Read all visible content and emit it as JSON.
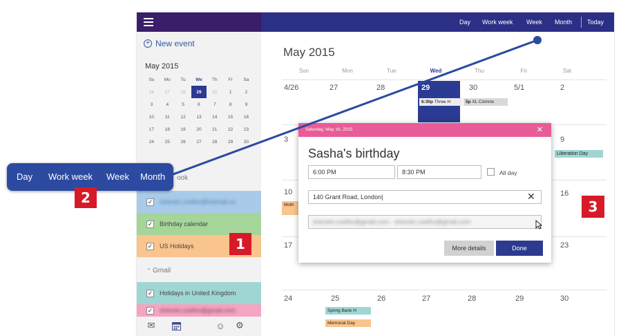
{
  "sidebar": {
    "new_event": "New event",
    "mini_title": "May 2015",
    "mini_dows": [
      "Su",
      "Mo",
      "Tu",
      "We",
      "Th",
      "Fr",
      "Sa"
    ],
    "mini_weeks": [
      [
        "26",
        "27",
        "28",
        "29",
        "30",
        "1",
        "2"
      ],
      [
        "3",
        "4",
        "5",
        "6",
        "7",
        "8",
        "9"
      ],
      [
        "10",
        "11",
        "12",
        "13",
        "14",
        "15",
        "16"
      ],
      [
        "17",
        "18",
        "19",
        "20",
        "21",
        "22",
        "23"
      ],
      [
        "24",
        "25",
        "26",
        "27",
        "28",
        "29",
        "30"
      ]
    ],
    "outlook_label": "ook",
    "account_email": "sherwin.coelho@hotmail.co",
    "calendars": [
      "Birthday calendar",
      "US Holidays"
    ],
    "gmail_label": "Gmail",
    "gmail_calendars": [
      "Holidays in United Kingdom",
      "sherwin.coelho@gmail.com"
    ],
    "checkmark": "✓"
  },
  "topbar": {
    "views": [
      "Day",
      "Work week",
      "Week",
      "Month",
      "Today"
    ]
  },
  "main": {
    "month_title": "May 2015",
    "dows": [
      "Sun",
      "Mon",
      "Tue",
      "Wed",
      "Thu",
      "Fri",
      "Sat"
    ],
    "week1": [
      "4/26",
      "27",
      "28",
      "29",
      "30",
      "5/1",
      "2"
    ],
    "week2_sun": "3",
    "week2_sat": "9",
    "week3_sun": "10",
    "week3_sat": "16",
    "week4_sun": "17",
    "week4_sat": "23",
    "week5": [
      "24",
      "25",
      "26",
      "27",
      "28",
      "29",
      "30"
    ],
    "events": {
      "three_time": "6:30p",
      "three_title": "Three H",
      "xl_time": "5p",
      "xl_title": "XL Comms",
      "liberation": "Liberation Day",
      "moth": "Moth",
      "spring": "Spring Bank H",
      "memorial": "Memorial Day"
    }
  },
  "dialog": {
    "date": "Saturday, May 16, 2015",
    "close": "✕",
    "title": "Sasha's birthday",
    "start": "6:00 PM",
    "end": "8:30 PM",
    "allday": "All day",
    "location": "140 Grant Road, London",
    "clear": "✕",
    "attendees": "sherwin.coelho@gmail.com - sherwin.coelho@gmail.com",
    "more": "More details",
    "done": "Done"
  },
  "callout": {
    "views": [
      "Day",
      "Work week",
      "Week",
      "Month"
    ],
    "badges": [
      "1",
      "2",
      "3"
    ]
  },
  "colors": {
    "topbar": "#2c2f86",
    "sidebar_top": "#3a1e6a",
    "dialog_header": "#e85c97",
    "selected_day": "#2b3a92",
    "callout": "#2c4aa0",
    "badge": "#d71a28",
    "cal_blue": "#a9cbe9",
    "cal_green": "#a6d59a",
    "cal_orange": "#f9c48d",
    "cal_teal": "#9fd6d4",
    "cal_pink": "#f4a5c3"
  }
}
